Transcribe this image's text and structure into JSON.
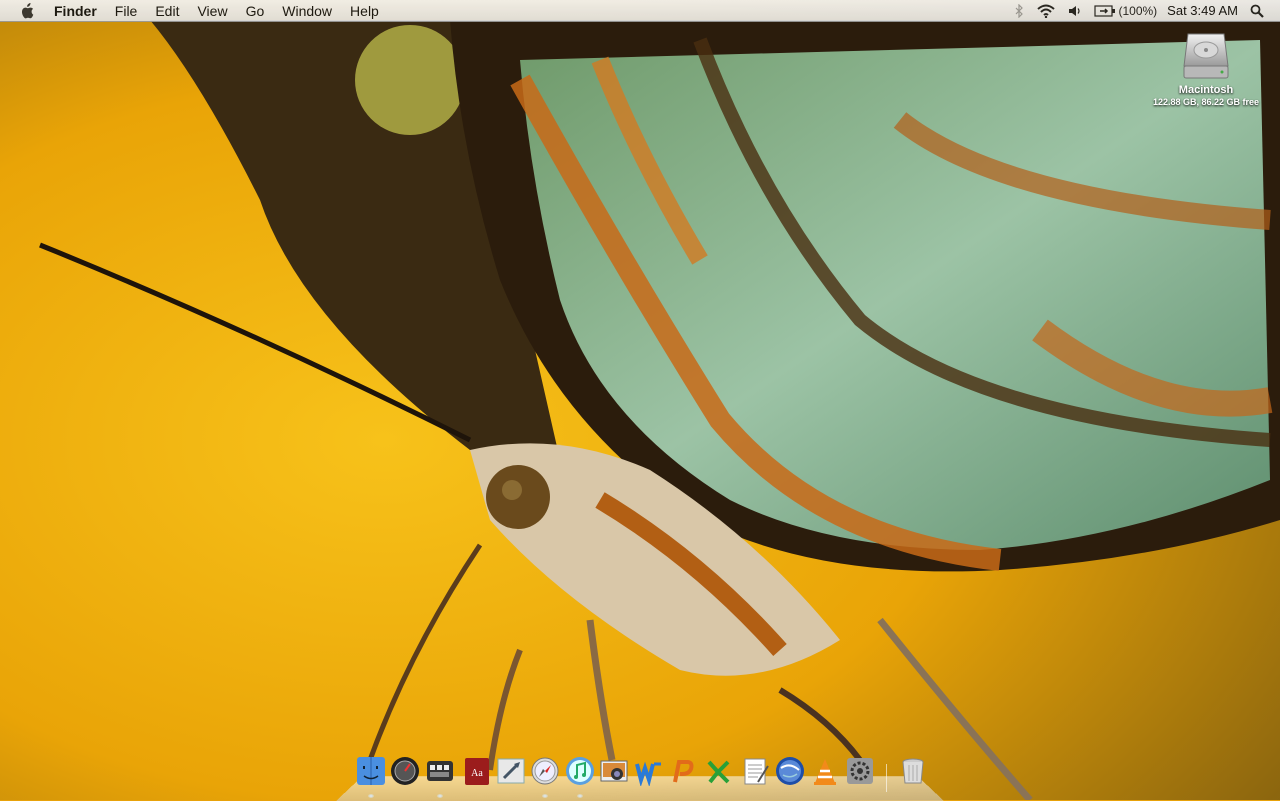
{
  "menubar": {
    "app_name": "Finder",
    "menus": [
      "File",
      "Edit",
      "View",
      "Go",
      "Window",
      "Help"
    ],
    "battery_percent": "(100%)",
    "clock": "Sat 3:49 AM",
    "icons": [
      "apple-logo",
      "bluetooth-icon",
      "wifi-icon",
      "volume-icon",
      "battery-icon",
      "spotlight-icon"
    ]
  },
  "desktop": {
    "drive_name": "Macintosh",
    "drive_info": "122.88 GB, 86.22 GB free"
  },
  "dock": {
    "items": [
      "finder",
      "front-row",
      "dashboard",
      "dictionary",
      "mail",
      "safari",
      "itunes",
      "iphoto",
      "microsoft-word",
      "microsoft-powerpoint",
      "microsoft-excel",
      "textedit",
      "google-earth",
      "vlc",
      "system-preferences",
      "trash"
    ]
  }
}
